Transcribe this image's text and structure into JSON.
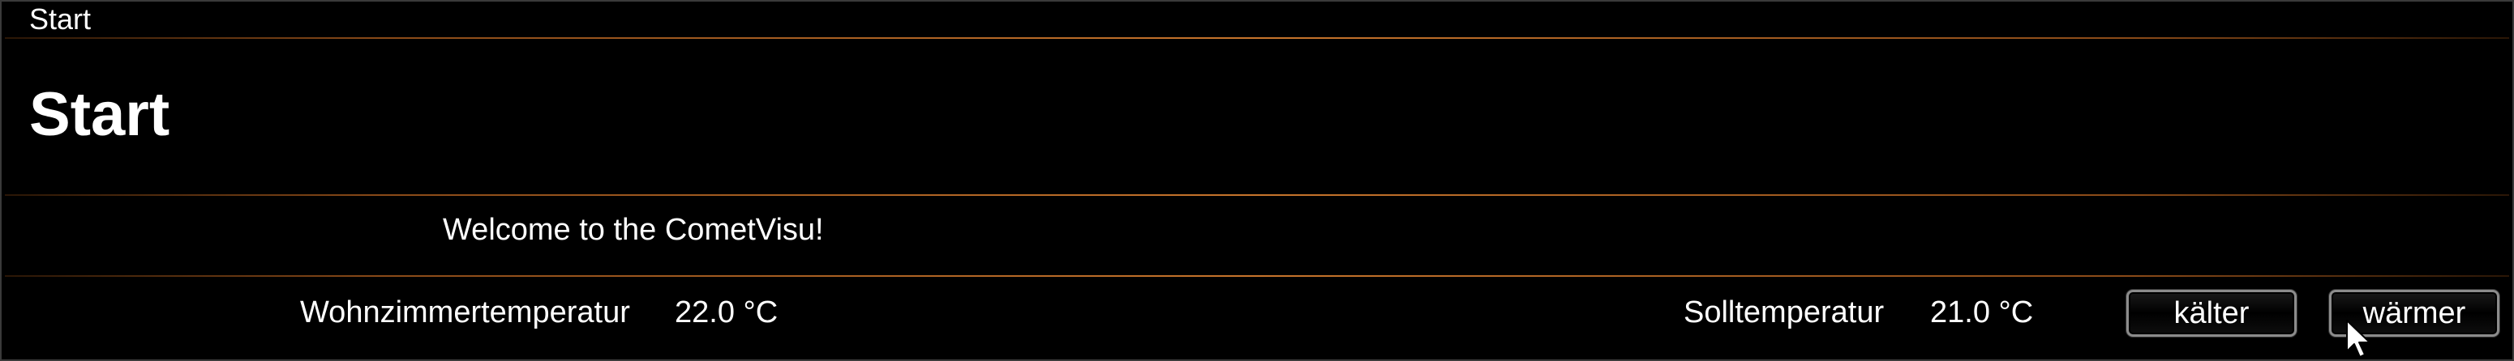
{
  "nav": {
    "path": "Start"
  },
  "page": {
    "title": "Start"
  },
  "welcome": {
    "text": "Welcome to the CometVisu!"
  },
  "living_room": {
    "label": "Wohnzimmertemperatur",
    "value": "22.0 °C"
  },
  "setpoint": {
    "label": "Solltemperatur",
    "value": "21.0 °C"
  },
  "buttons": {
    "colder": "kälter",
    "warmer": "wärmer"
  },
  "colors": {
    "background": "#000000",
    "text": "#ffffff",
    "accent_line": "#c8752c",
    "button_border": "#8c8c8c"
  },
  "icons": {
    "cursor": "mouse-pointer-icon"
  }
}
